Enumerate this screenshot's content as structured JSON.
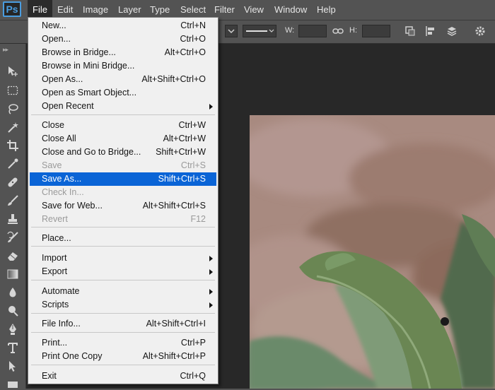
{
  "app": {
    "logo": "Ps"
  },
  "menubar": {
    "items": [
      "File",
      "Edit",
      "Image",
      "Layer",
      "Type",
      "Select",
      "Filter",
      "View",
      "Window",
      "Help"
    ],
    "active": "File"
  },
  "options": {
    "w_label": "W:",
    "h_label": "H:"
  },
  "file_menu": {
    "items": [
      {
        "label": "New...",
        "shortcut": "Ctrl+N"
      },
      {
        "label": "Open...",
        "shortcut": "Ctrl+O"
      },
      {
        "label": "Browse in Bridge...",
        "shortcut": "Alt+Ctrl+O"
      },
      {
        "label": "Browse in Mini Bridge...",
        "shortcut": ""
      },
      {
        "label": "Open As...",
        "shortcut": "Alt+Shift+Ctrl+O"
      },
      {
        "label": "Open as Smart Object...",
        "shortcut": ""
      },
      {
        "label": "Open Recent",
        "shortcut": "",
        "submenu": true
      },
      {
        "label": "Close",
        "shortcut": "Ctrl+W"
      },
      {
        "label": "Close All",
        "shortcut": "Alt+Ctrl+W"
      },
      {
        "label": "Close and Go to Bridge...",
        "shortcut": "Shift+Ctrl+W"
      },
      {
        "label": "Save",
        "shortcut": "Ctrl+S",
        "disabled": true
      },
      {
        "label": "Save As...",
        "shortcut": "Shift+Ctrl+S",
        "highlighted": true
      },
      {
        "label": "Check In...",
        "shortcut": "",
        "disabled": true
      },
      {
        "label": "Save for Web...",
        "shortcut": "Alt+Shift+Ctrl+S"
      },
      {
        "label": "Revert",
        "shortcut": "F12",
        "disabled": true
      },
      {
        "label": "Place...",
        "shortcut": ""
      },
      {
        "label": "Import",
        "shortcut": "",
        "submenu": true
      },
      {
        "label": "Export",
        "shortcut": "",
        "submenu": true
      },
      {
        "label": "Automate",
        "shortcut": "",
        "submenu": true
      },
      {
        "label": "Scripts",
        "shortcut": "",
        "submenu": true
      },
      {
        "label": "File Info...",
        "shortcut": "Alt+Shift+Ctrl+I"
      },
      {
        "label": "Print...",
        "shortcut": "Ctrl+P"
      },
      {
        "label": "Print One Copy",
        "shortcut": "Alt+Shift+Ctrl+P"
      },
      {
        "label": "Exit",
        "shortcut": "Ctrl+Q"
      }
    ]
  },
  "tools": [
    "move-tool-icon",
    "marquee-tool-icon",
    "lasso-tool-icon",
    "magic-wand-icon",
    "crop-tool-icon",
    "eyedropper-icon",
    "healing-brush-icon",
    "brush-tool-icon",
    "clone-stamp-icon",
    "history-brush-icon",
    "eraser-icon",
    "gradient-tool-icon",
    "blur-tool-icon",
    "dodge-tool-icon",
    "pen-tool-icon",
    "type-tool-icon",
    "path-selection-icon"
  ],
  "colors": {
    "highlight": "#0a64d6",
    "menu_bg": "#f0f0f0",
    "ui_bg": "#535353"
  }
}
